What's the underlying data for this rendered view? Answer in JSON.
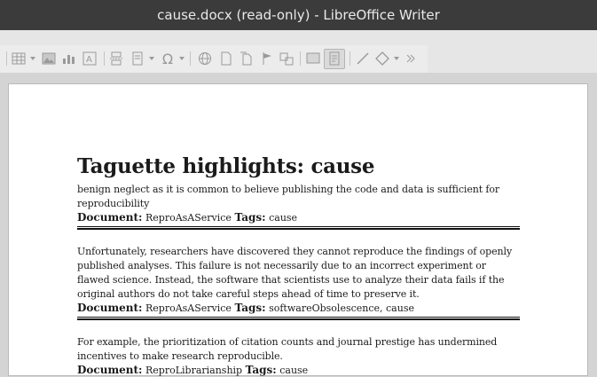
{
  "window": {
    "title": "cause.docx (read-only) - LibreOffice Writer"
  },
  "toolbar": {
    "icons": [
      "table-icon",
      "image-icon",
      "textbox-icon",
      "page-break-icon",
      "field-icon",
      "special-character-icon",
      "hyperlink-icon",
      "footnote-icon",
      "endnote-icon",
      "bookmark-icon",
      "cross-reference-icon",
      "comment-icon",
      "track-changes-icon",
      "line-icon",
      "basic-shapes-icon"
    ],
    "special_char_glyph": "Ω"
  },
  "document": {
    "heading": "Taguette highlights: cause",
    "document_label": "Document:",
    "tags_label": "Tags:",
    "highlights": [
      {
        "text": "benign neglect as it is common to believe publishing the code and data is sufficient for reproducibility",
        "document": "ReproAsAService",
        "tags": "cause"
      },
      {
        "text": "Unfortunately, researchers have discovered they cannot reproduce the findings of openly published analyses. This failure is not necessarily due to an incorrect experiment or flawed science. Instead, the software that scientists use to analyze their data fails if the original authors do not take careful steps ahead of time to preserve it.",
        "document": "ReproAsAService",
        "tags": "softwareObsolescence, cause"
      },
      {
        "text": "For example, the prioritization of citation counts and journal prestige has undermined incentives to make research reproducible.",
        "document": "ReproLibrarianship",
        "tags": "cause"
      }
    ]
  }
}
